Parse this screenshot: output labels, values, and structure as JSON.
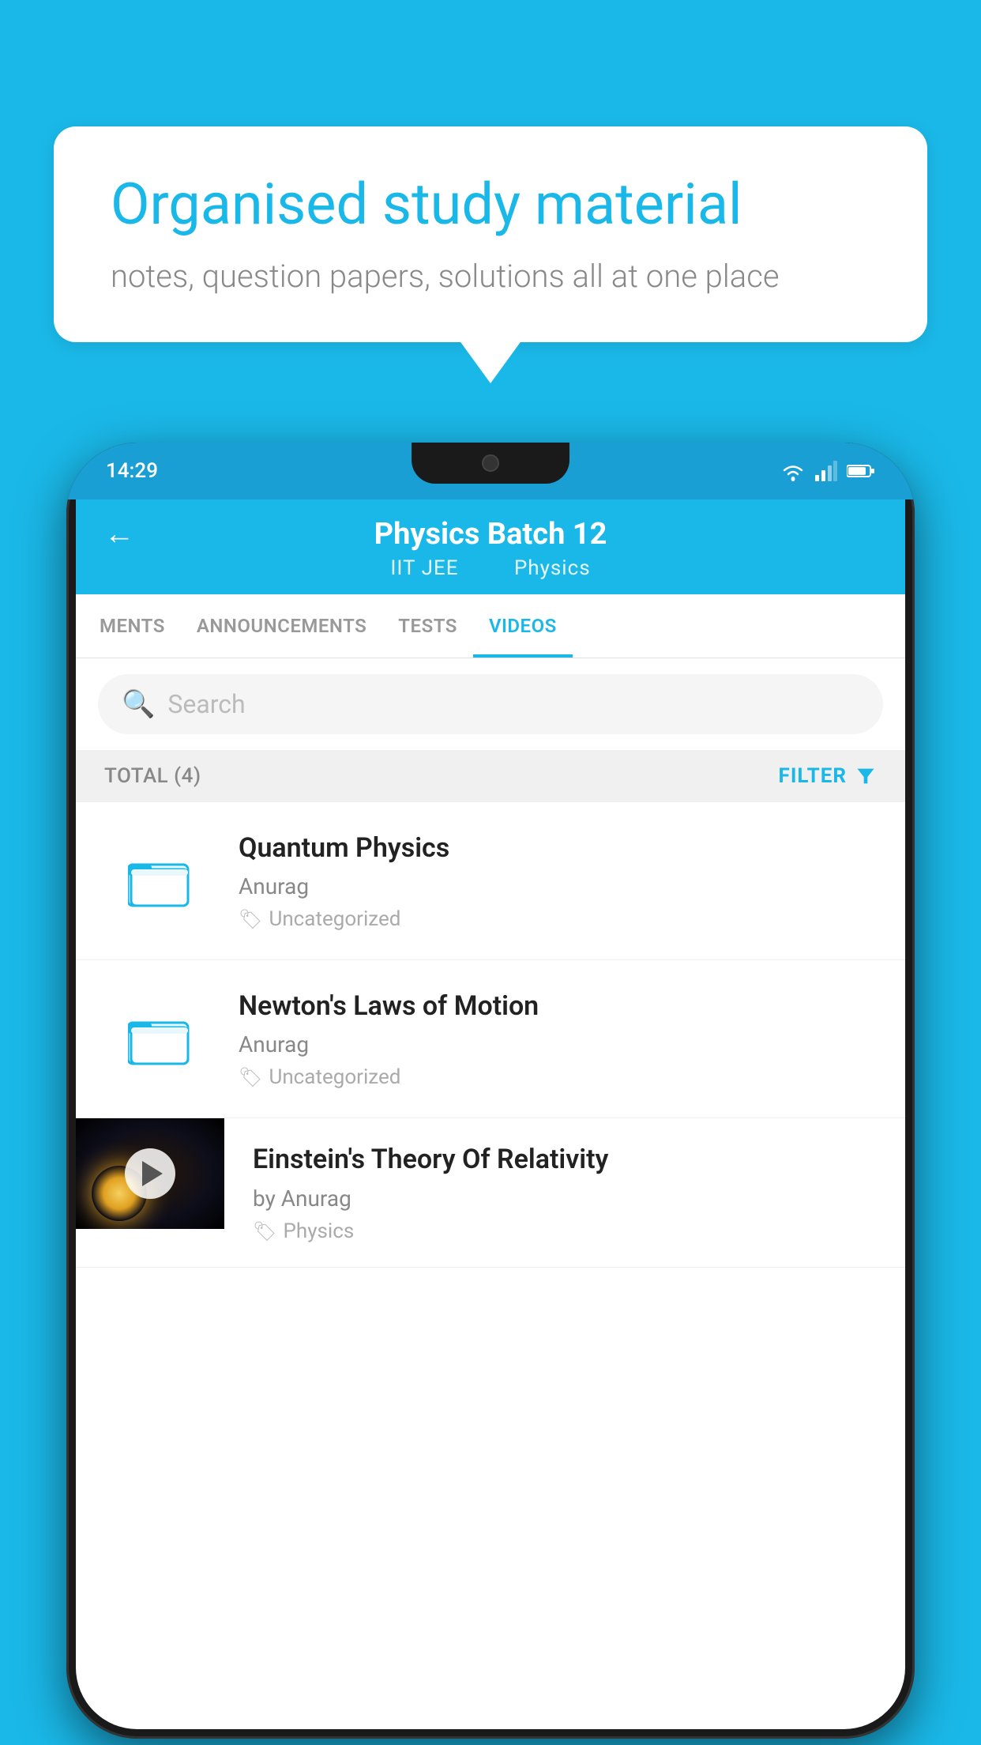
{
  "background_color": "#1ab8e8",
  "speech_bubble": {
    "heading": "Organised study material",
    "subtext": "notes, question papers, solutions all at one place"
  },
  "phone": {
    "status_bar": {
      "time": "14:29",
      "wifi": "▾",
      "signal": "▴",
      "battery": "▌"
    },
    "header": {
      "title": "Physics Batch 12",
      "subtitle_part1": "IIT JEE",
      "subtitle_part2": "Physics",
      "back_label": "←"
    },
    "tabs": [
      {
        "label": "MENTS",
        "active": false
      },
      {
        "label": "ANNOUNCEMENTS",
        "active": false
      },
      {
        "label": "TESTS",
        "active": false
      },
      {
        "label": "VIDEOS",
        "active": true
      }
    ],
    "search": {
      "placeholder": "Search"
    },
    "filter_bar": {
      "total_label": "TOTAL (4)",
      "filter_label": "FILTER"
    },
    "video_items": [
      {
        "id": 1,
        "title": "Quantum Physics",
        "author": "Anurag",
        "tag": "Uncategorized",
        "has_thumbnail": false
      },
      {
        "id": 2,
        "title": "Newton's Laws of Motion",
        "author": "Anurag",
        "tag": "Uncategorized",
        "has_thumbnail": false
      },
      {
        "id": 3,
        "title": "Einstein's Theory Of Relativity",
        "author": "by Anurag",
        "tag": "Physics",
        "has_thumbnail": true
      }
    ]
  }
}
